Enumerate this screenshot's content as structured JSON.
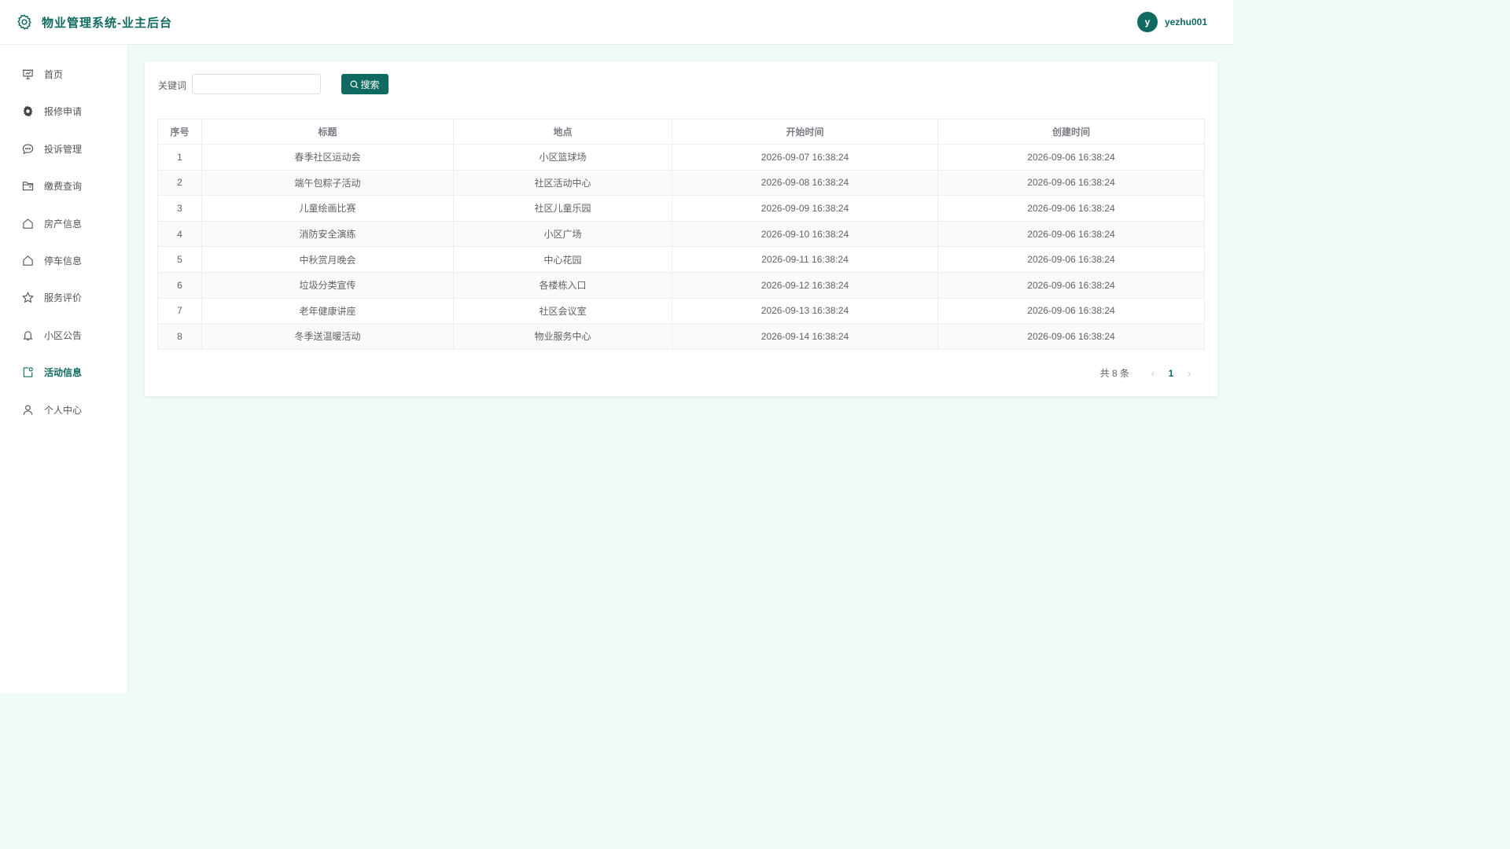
{
  "header": {
    "title": "物业管理系统-业主后台",
    "avatar_letter": "y",
    "username": "yezhu001"
  },
  "sidebar": {
    "items": [
      {
        "label": "首页",
        "icon": "presentation-icon"
      },
      {
        "label": "报修申请",
        "icon": "gear-icon"
      },
      {
        "label": "投诉管理",
        "icon": "chat-bubble-icon"
      },
      {
        "label": "缴费查询",
        "icon": "folder-icon"
      },
      {
        "label": "房产信息",
        "icon": "house-icon"
      },
      {
        "label": "停车信息",
        "icon": "house-icon"
      },
      {
        "label": "服务评价",
        "icon": "star-icon"
      },
      {
        "label": "小区公告",
        "icon": "bell-icon"
      },
      {
        "label": "活动信息",
        "icon": "activity-icon"
      },
      {
        "label": "个人中心",
        "icon": "user-icon"
      }
    ],
    "active": "活动信息"
  },
  "search": {
    "label": "关键词",
    "value": "",
    "placeholder": "",
    "button": "搜索"
  },
  "table": {
    "columns": [
      "序号",
      "标题",
      "地点",
      "开始时间",
      "创建时间"
    ],
    "rows": [
      [
        "1",
        "春季社区运动会",
        "小区篮球场",
        "2026-09-07 16:38:24",
        "2026-09-06 16:38:24"
      ],
      [
        "2",
        "端午包粽子活动",
        "社区活动中心",
        "2026-09-08 16:38:24",
        "2026-09-06 16:38:24"
      ],
      [
        "3",
        "儿童绘画比赛",
        "社区儿童乐园",
        "2026-09-09 16:38:24",
        "2026-09-06 16:38:24"
      ],
      [
        "4",
        "消防安全演练",
        "小区广场",
        "2026-09-10 16:38:24",
        "2026-09-06 16:38:24"
      ],
      [
        "5",
        "中秋赏月晚会",
        "中心花园",
        "2026-09-11 16:38:24",
        "2026-09-06 16:38:24"
      ],
      [
        "6",
        "垃圾分类宣传",
        "各楼栋入口",
        "2026-09-12 16:38:24",
        "2026-09-06 16:38:24"
      ],
      [
        "7",
        "老年健康讲座",
        "社区会议室",
        "2026-09-13 16:38:24",
        "2026-09-06 16:38:24"
      ],
      [
        "8",
        "冬季送温暖活动",
        "物业服务中心",
        "2026-09-14 16:38:24",
        "2026-09-06 16:38:24"
      ]
    ]
  },
  "pagination": {
    "total_text": "共 8 条",
    "current_page": "1",
    "prev": "‹",
    "next": "›"
  },
  "colors": {
    "primary": "#0f6b5f",
    "background": "#f0faf8"
  }
}
